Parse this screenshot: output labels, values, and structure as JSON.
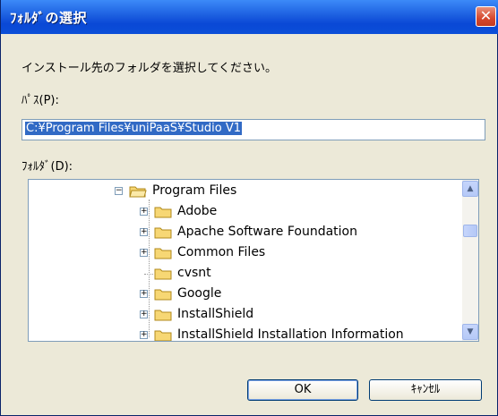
{
  "window": {
    "title": "ﾌｫﾙﾀﾞの選択",
    "close_glyph": "✕"
  },
  "instruction": "インストール先のフォルダを選択してください。",
  "path": {
    "label": "ﾊﾟｽ(P):",
    "value": "C:¥Program Files¥uniPaaS¥Studio V1"
  },
  "folder": {
    "label": "ﾌｫﾙﾀﾞ(D):"
  },
  "tree": {
    "items": [
      {
        "label": "Program Files",
        "expander": "−",
        "icon": "folder-open-icon"
      },
      {
        "label": "Adobe",
        "expander": "+",
        "icon": "folder-icon"
      },
      {
        "label": "Apache Software Foundation",
        "expander": "+",
        "icon": "folder-icon"
      },
      {
        "label": "Common Files",
        "expander": "+",
        "icon": "folder-icon"
      },
      {
        "label": "cvsnt",
        "expander": "",
        "icon": "folder-icon"
      },
      {
        "label": "Google",
        "expander": "+",
        "icon": "folder-icon"
      },
      {
        "label": "InstallShield",
        "expander": "+",
        "icon": "folder-icon"
      },
      {
        "label": "InstallShield Installation Information",
        "expander": "+",
        "icon": "folder-icon"
      }
    ]
  },
  "scrollbar": {
    "up_glyph": "▲",
    "down_glyph": "▼"
  },
  "buttons": {
    "ok": "OK",
    "cancel": "ｷｬﾝｾﾙ"
  },
  "colors": {
    "titlebar": "#0a48d6",
    "selection": "#316ac5",
    "close": "#d6472d"
  }
}
